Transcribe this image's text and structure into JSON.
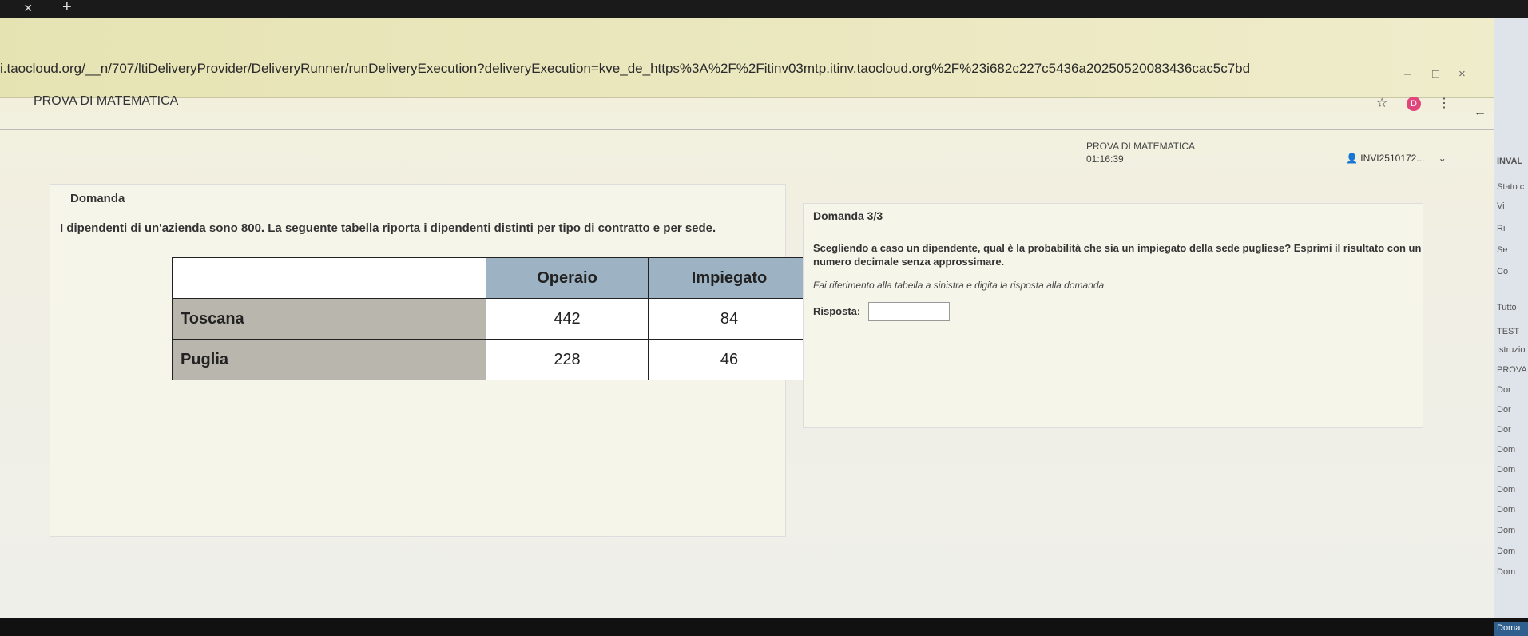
{
  "browser": {
    "tab_close": "×",
    "tab_new": "+",
    "url": "i.taocloud.org/__n/707/ltiDeliveryProvider/DeliveryRunner/runDeliveryExecution?deliveryExecution=kve_de_https%3A%2F%2Fitinv03mtp.itinv.taocloud.org%2F%23i682c227c5436a20250520083436cac5c7bd",
    "tab_title": "PROVA DI MATEMATICA",
    "window_min": "–",
    "window_max": "□",
    "window_close": "×",
    "star_icon": "☆",
    "avatar_letter": "D",
    "menu_icon": "⋮",
    "back_icon": "←"
  },
  "header": {
    "test_title": "PROVA DI MATEMATICA",
    "timer": "01:16:39",
    "user": "INVI2510172...",
    "user_icon": "👤",
    "chevron": "⌄"
  },
  "left": {
    "label": "Domanda",
    "stem": "I dipendenti di un'azienda sono 800. La seguente tabella riporta i dipendenti distinti per tipo di contratto e per sede.",
    "table": {
      "columns": [
        "Operaio",
        "Impiegato"
      ],
      "rows": [
        {
          "label": "Toscana",
          "values": [
            "442",
            "84"
          ]
        },
        {
          "label": "Puglia",
          "values": [
            "228",
            "46"
          ]
        }
      ]
    }
  },
  "right": {
    "title": "Domanda 3/3",
    "question": "Scegliendo a caso un dipendente, qual è la probabilità che sia un impiegato della sede pugliese? Esprimi il risultato con un numero decimale senza approssimare.",
    "hint": "Fai riferimento alla tabella a sinistra e digita la risposta alla domanda.",
    "answer_label": "Risposta:",
    "answer_value": ""
  },
  "sidebar": {
    "items": [
      "INVAL",
      "Stato c",
      "Vi",
      "Ri",
      "Se",
      "Co",
      "Tutto",
      "TEST",
      "Istruzio",
      "PROVA D",
      "Dor",
      "Dor",
      "Dor",
      "Dom",
      "Dom",
      "Dom",
      "Dom",
      "Dom",
      "Dom",
      "Dom",
      "Doma"
    ]
  }
}
